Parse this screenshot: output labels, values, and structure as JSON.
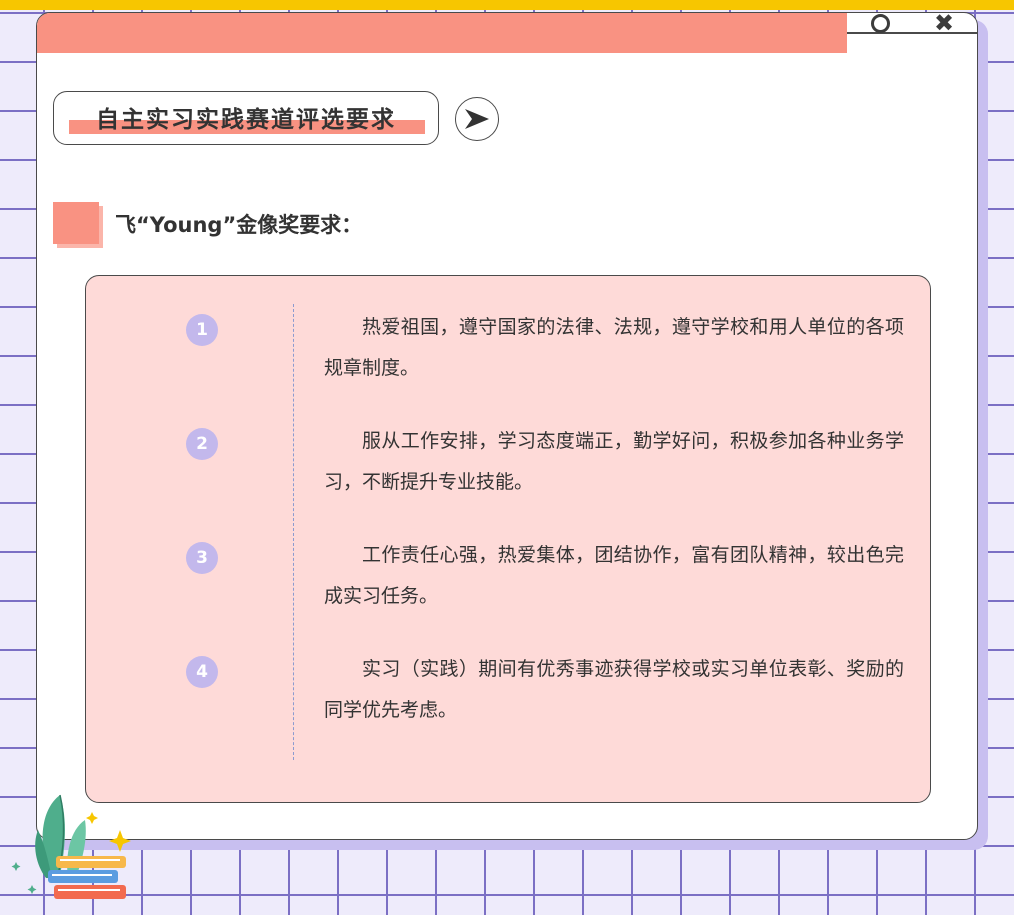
{
  "window": {
    "close_icon": "close-icon",
    "circle_icon": "circle-icon"
  },
  "header": {
    "title": "自主实习实践赛道评选要求",
    "arrow_icon": "play-arrow-icon"
  },
  "section": {
    "title": "飞“Young”金像奖要求："
  },
  "requirements": [
    {
      "num": "1",
      "text": "热爱祖国，遵守国家的法律、法规，遵守学校和用人单位的各项规章制度。"
    },
    {
      "num": "2",
      "text": "服从工作安排，学习态度端正，勤学好问，积极参加各种业务学习，不断提升专业技能。"
    },
    {
      "num": "3",
      "text": "工作责任心强，热爱集体，团结协作，富有团队精神，较出色完成实习任务。"
    },
    {
      "num": "4",
      "text": "实习（实践）期间有优秀事迹获得学校或实习单位表彰、奖励的同学优先考虑。"
    }
  ],
  "colors": {
    "accent": "#f99282",
    "panel": "#fedad8",
    "badge": "#c3b8ec",
    "grid": "#7b6fc4",
    "top_bar": "#f7c600"
  }
}
